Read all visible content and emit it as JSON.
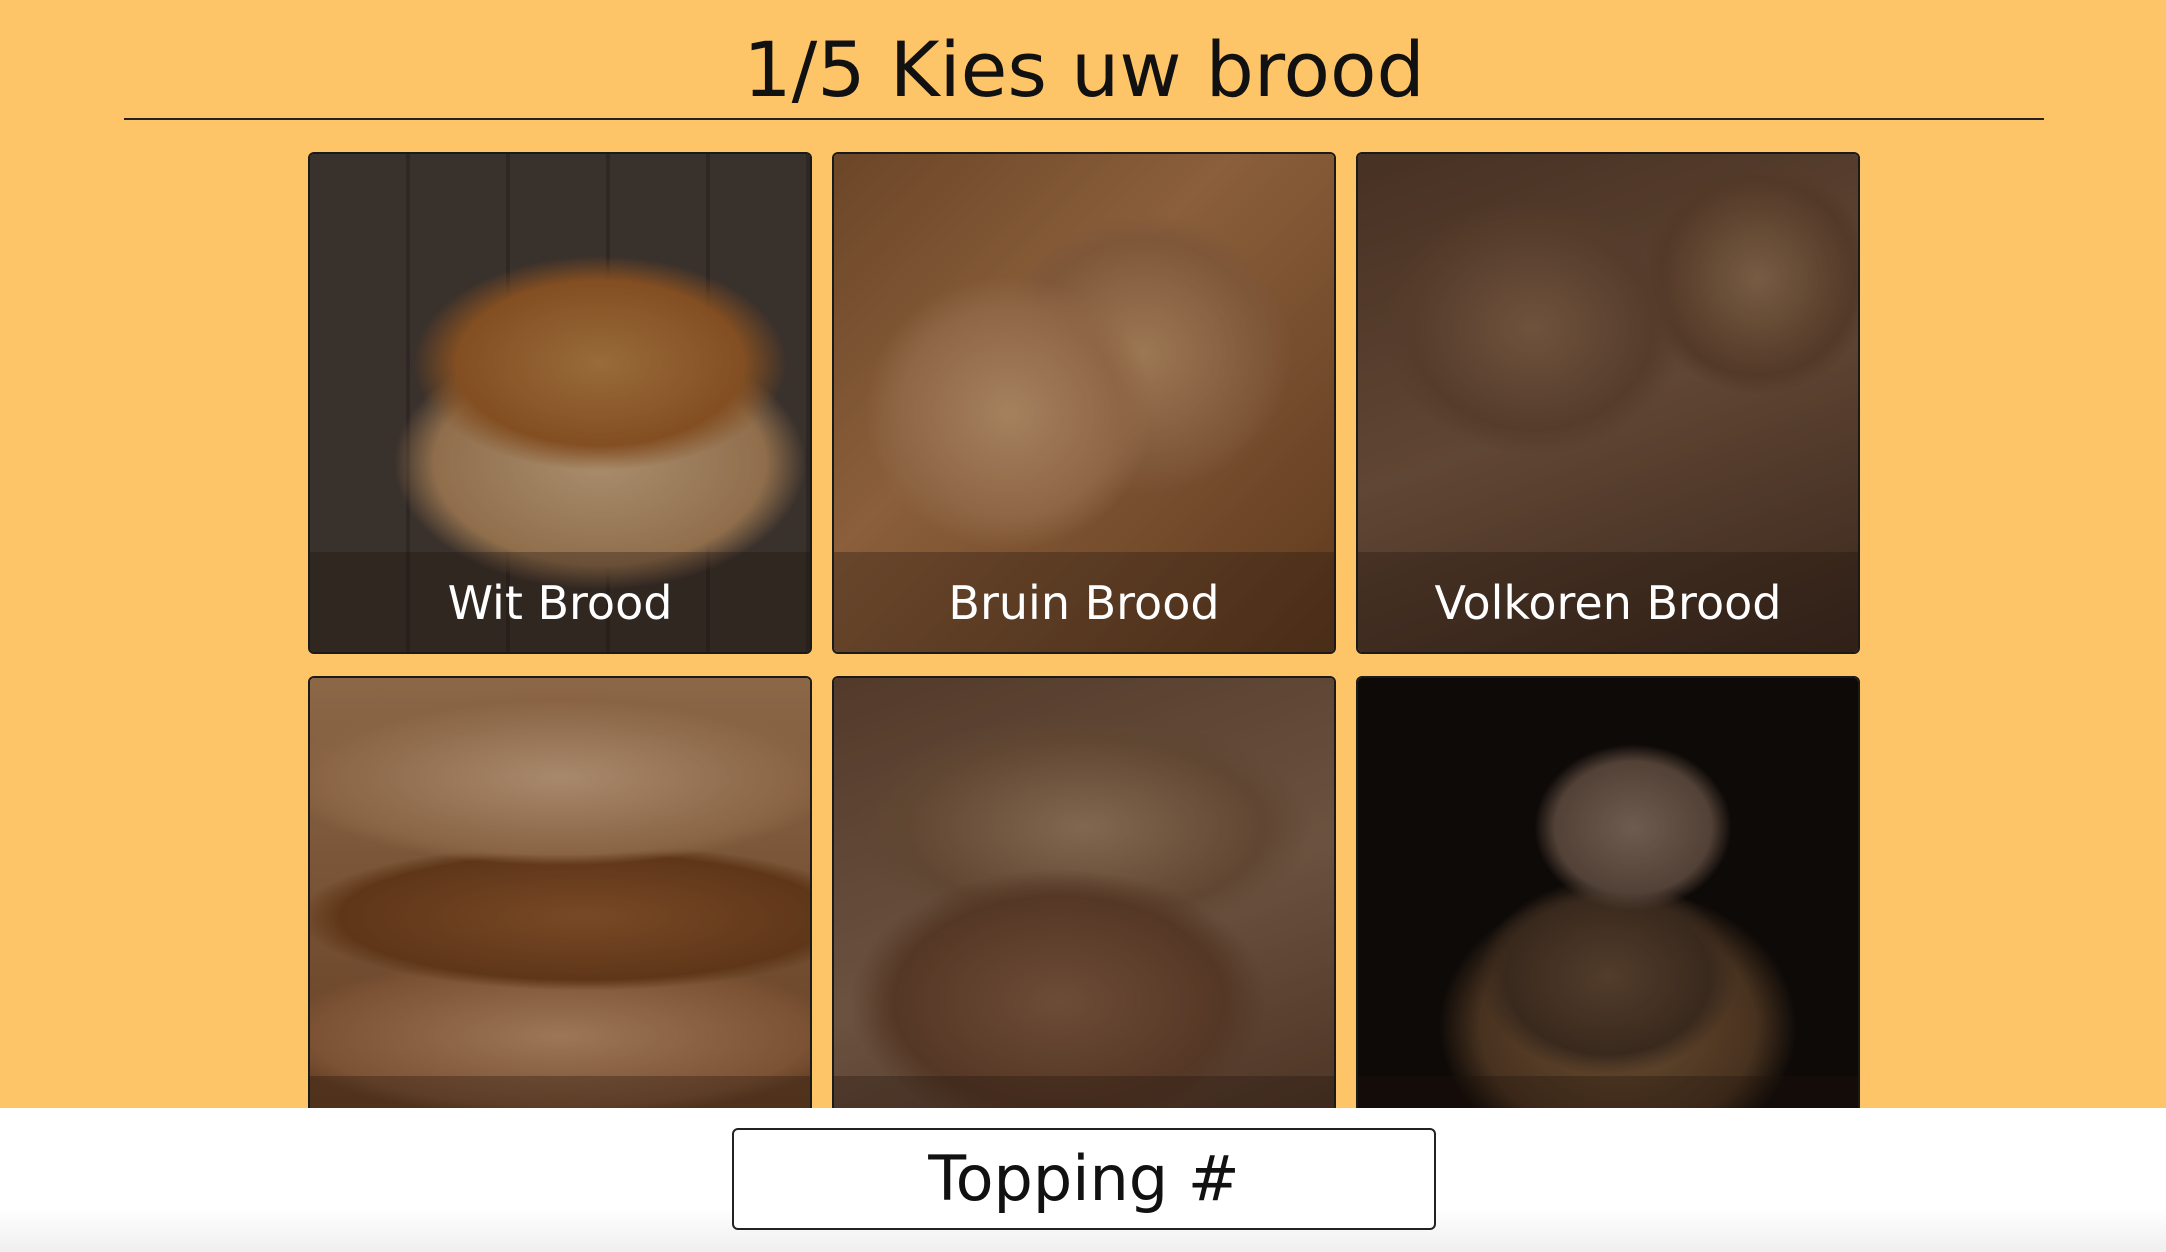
{
  "header": {
    "title": "1/5 Kies uw brood"
  },
  "bread_options": [
    {
      "label": "Wit Brood",
      "image": "white-bread-photo"
    },
    {
      "label": "Bruin Brood",
      "image": "brown-bread-photo"
    },
    {
      "label": "Volkoren Brood",
      "image": "wholegrain-bread-photo"
    },
    {
      "label": "",
      "image": "sliced-bread-photo"
    },
    {
      "label": "",
      "image": "seeded-bread-photo"
    },
    {
      "label": "",
      "image": "rye-bread-photo"
    }
  ],
  "footer": {
    "button_label": "Topping #"
  },
  "colors": {
    "background": "#fec468",
    "footer": "#ffffff"
  }
}
